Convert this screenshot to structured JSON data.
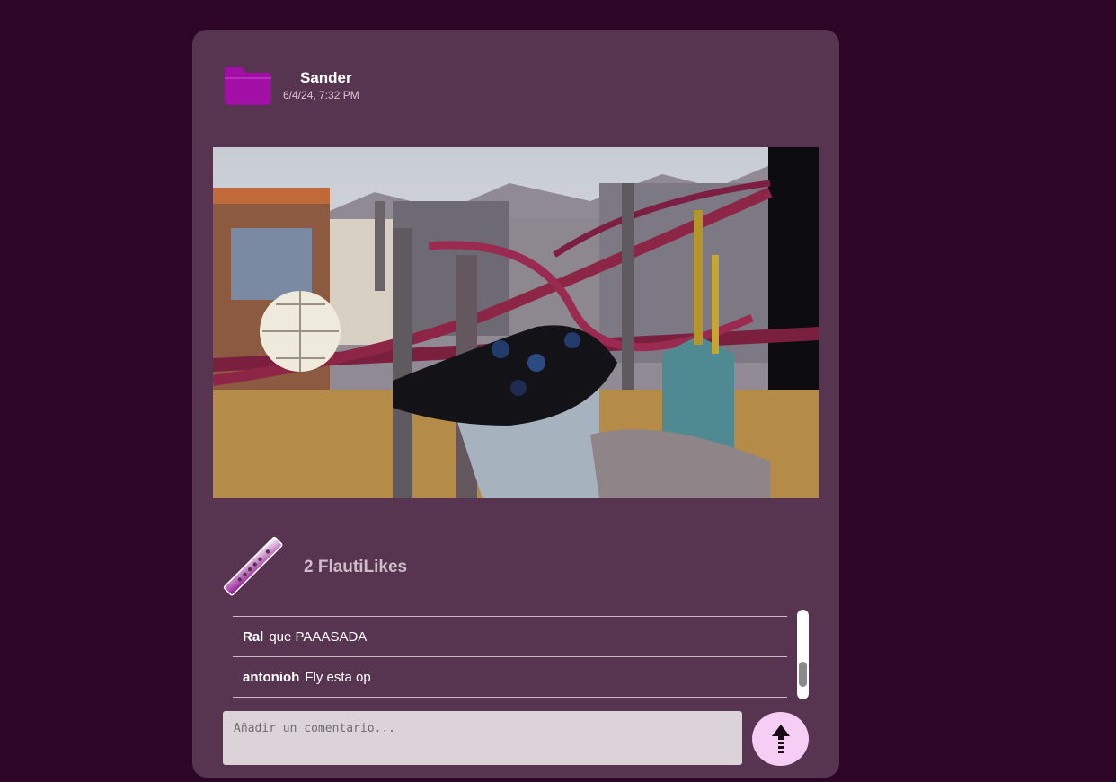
{
  "post": {
    "username": "Sander",
    "timestamp": "6/4/24, 7:32 PM",
    "likes_text": "2 FlautiLikes"
  },
  "comments": [
    {
      "author": "Ral",
      "text": "que PAAASADA"
    },
    {
      "author": "antonioh",
      "text": "Fly esta op"
    }
  ],
  "comment_input": {
    "placeholder": "Añadir un comentario..."
  },
  "icons": {
    "avatar": "folder-icon",
    "like": "flute-icon",
    "send": "arrow-up-icon"
  },
  "colors": {
    "background": "#2d0527",
    "card": "#57344f",
    "accent": "#a20fa6",
    "send_button": "#f6cdf4"
  }
}
